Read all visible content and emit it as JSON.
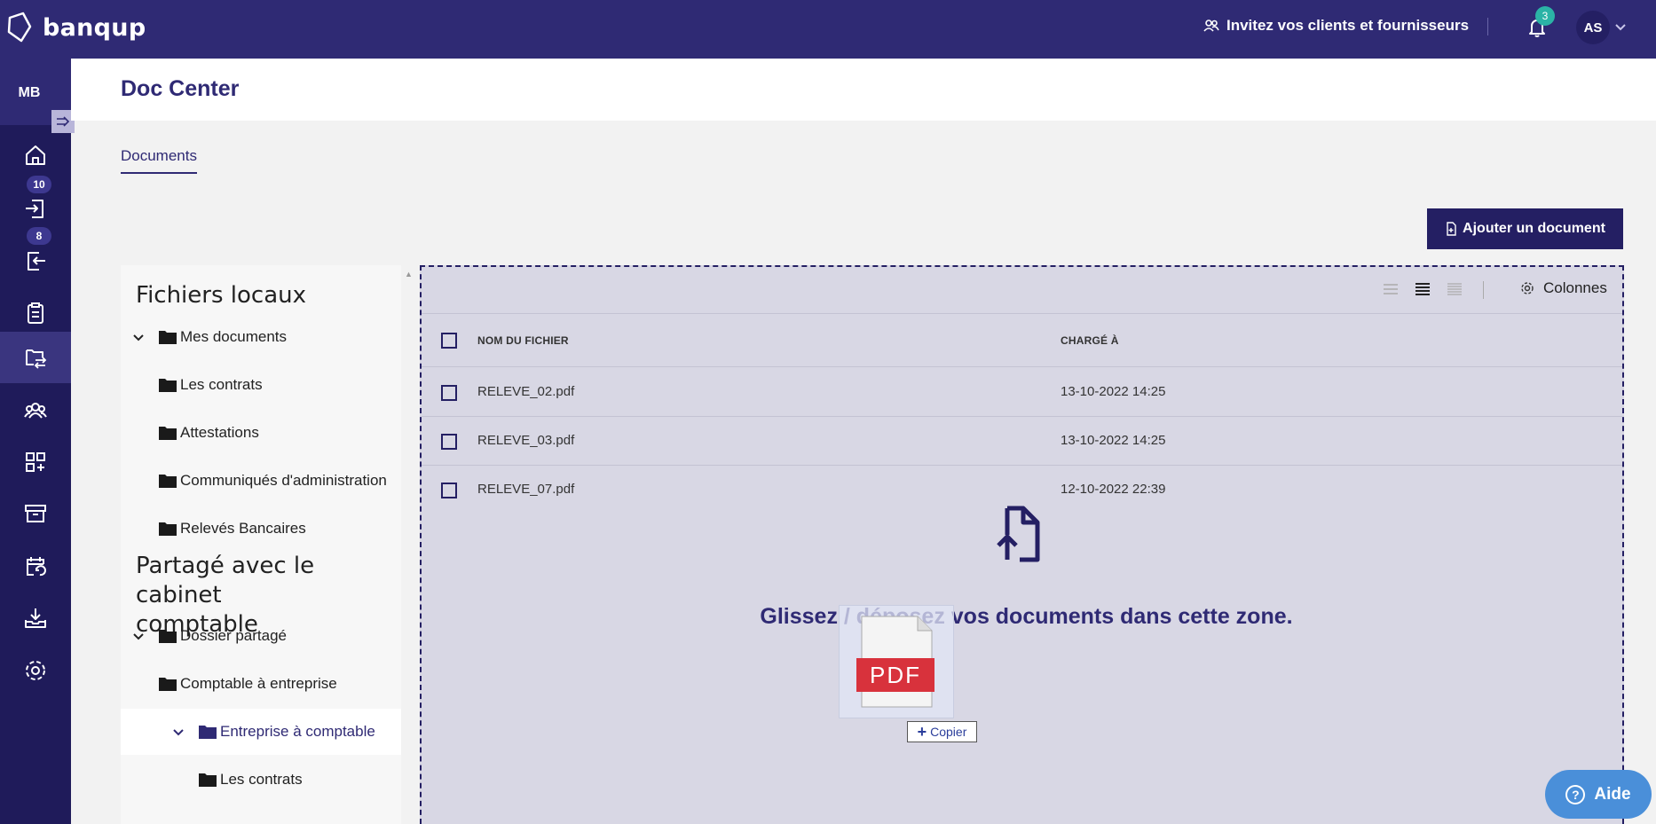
{
  "brand": {
    "name": "banqup",
    "accent": "#2f2a74",
    "sidebar_bg": "#1f1b5a"
  },
  "topbar": {
    "invite_label": "Invitez vos clients et fournisseurs",
    "notifications_count": "3",
    "user_initials": "AS"
  },
  "sidebar": {
    "initials": "MB",
    "items": [
      {
        "icon": "home-icon"
      },
      {
        "icon": "inbound-icon",
        "badge": "10"
      },
      {
        "icon": "outbound-icon",
        "badge": "8"
      },
      {
        "icon": "clipboard-icon"
      },
      {
        "icon": "doc-center-icon",
        "active": true
      },
      {
        "icon": "contacts-icon"
      },
      {
        "icon": "apps-icon"
      },
      {
        "icon": "archive-icon"
      },
      {
        "icon": "calendar-sync-icon"
      },
      {
        "icon": "download-tray-icon"
      },
      {
        "icon": "settings-icon"
      }
    ]
  },
  "page": {
    "title": "Doc Center",
    "tab_label": "Documents",
    "add_button_label": "Ajouter un document"
  },
  "tree": {
    "section_local": "Fichiers locaux",
    "section_shared_line1": "Partagé avec le cabinet",
    "section_shared_line2": "comptable",
    "local": [
      "Mes documents",
      "Les contrats",
      "Attestations",
      "Communiqués d'administration",
      "Relevés Bancaires"
    ],
    "shared": [
      "Dossier partagé",
      "Comptable à entreprise",
      "Entreprise à comptable",
      "Les contrats"
    ]
  },
  "table": {
    "columns_label": "Colonnes",
    "headers": {
      "name": "NOM DU FICHIER",
      "uploaded": "CHARGÉ À"
    },
    "rows": [
      {
        "name": "RELEVE_02.pdf",
        "uploaded": "13-10-2022 14:25"
      },
      {
        "name": "RELEVE_03.pdf",
        "uploaded": "13-10-2022 14:25"
      },
      {
        "name": "RELEVE_07.pdf",
        "uploaded": "12-10-2022 22:39"
      }
    ]
  },
  "dropzone": {
    "text": "Glissez / déposez vos documents dans cette zone."
  },
  "drag": {
    "file_label": "PDF",
    "tooltip": "Copier"
  },
  "help": {
    "label": "Aide"
  }
}
